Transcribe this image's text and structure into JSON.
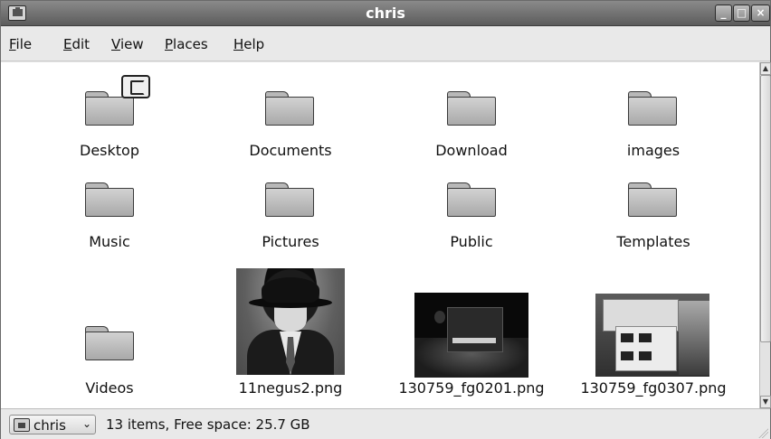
{
  "window": {
    "title": "chris"
  },
  "menu": [
    {
      "accel": "F",
      "rest": "ile"
    },
    {
      "accel": "E",
      "rest": "dit"
    },
    {
      "accel": "V",
      "rest": "iew"
    },
    {
      "accel": "P",
      "rest": "laces"
    },
    {
      "accel": "H",
      "rest": "elp"
    }
  ],
  "items": [
    {
      "name": "Desktop",
      "type": "folder",
      "emblem": "note-emblem"
    },
    {
      "name": "Documents",
      "type": "folder"
    },
    {
      "name": "Download",
      "type": "folder"
    },
    {
      "name": "images",
      "type": "folder"
    },
    {
      "name": "Music",
      "type": "folder"
    },
    {
      "name": "Pictures",
      "type": "folder"
    },
    {
      "name": "Public",
      "type": "folder"
    },
    {
      "name": "Templates",
      "type": "folder"
    },
    {
      "name": "Videos",
      "type": "folder"
    },
    {
      "name": "11negus2.png",
      "type": "image"
    },
    {
      "name": "130759_fg0201.png",
      "type": "image"
    },
    {
      "name": "130759_fg0307.png",
      "type": "image"
    }
  ],
  "status": {
    "location": "chris",
    "summary": "13 items, Free space: 25.7 GB"
  }
}
